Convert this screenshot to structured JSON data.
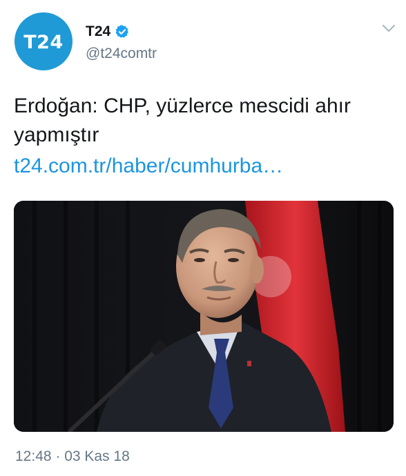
{
  "account": {
    "avatar_text": "T24",
    "display_name": "T24",
    "handle": "@t24comtr",
    "verified_icon": "verified-badge-icon",
    "avatar_color": "#1f9ad6"
  },
  "tweet": {
    "text": "Erdoğan: CHP, yüzlerce mescidi ahır yapmıştır",
    "link": "t24.com.tr/haber/cumhurba…",
    "timestamp": "12:48 · 03 Kas 18"
  },
  "media": {
    "description_icon": "news-photo",
    "flag_color": "#d8262e"
  },
  "colors": {
    "link": "#1b95e0",
    "secondary_text": "#657786",
    "primary_text": "#14171a"
  }
}
